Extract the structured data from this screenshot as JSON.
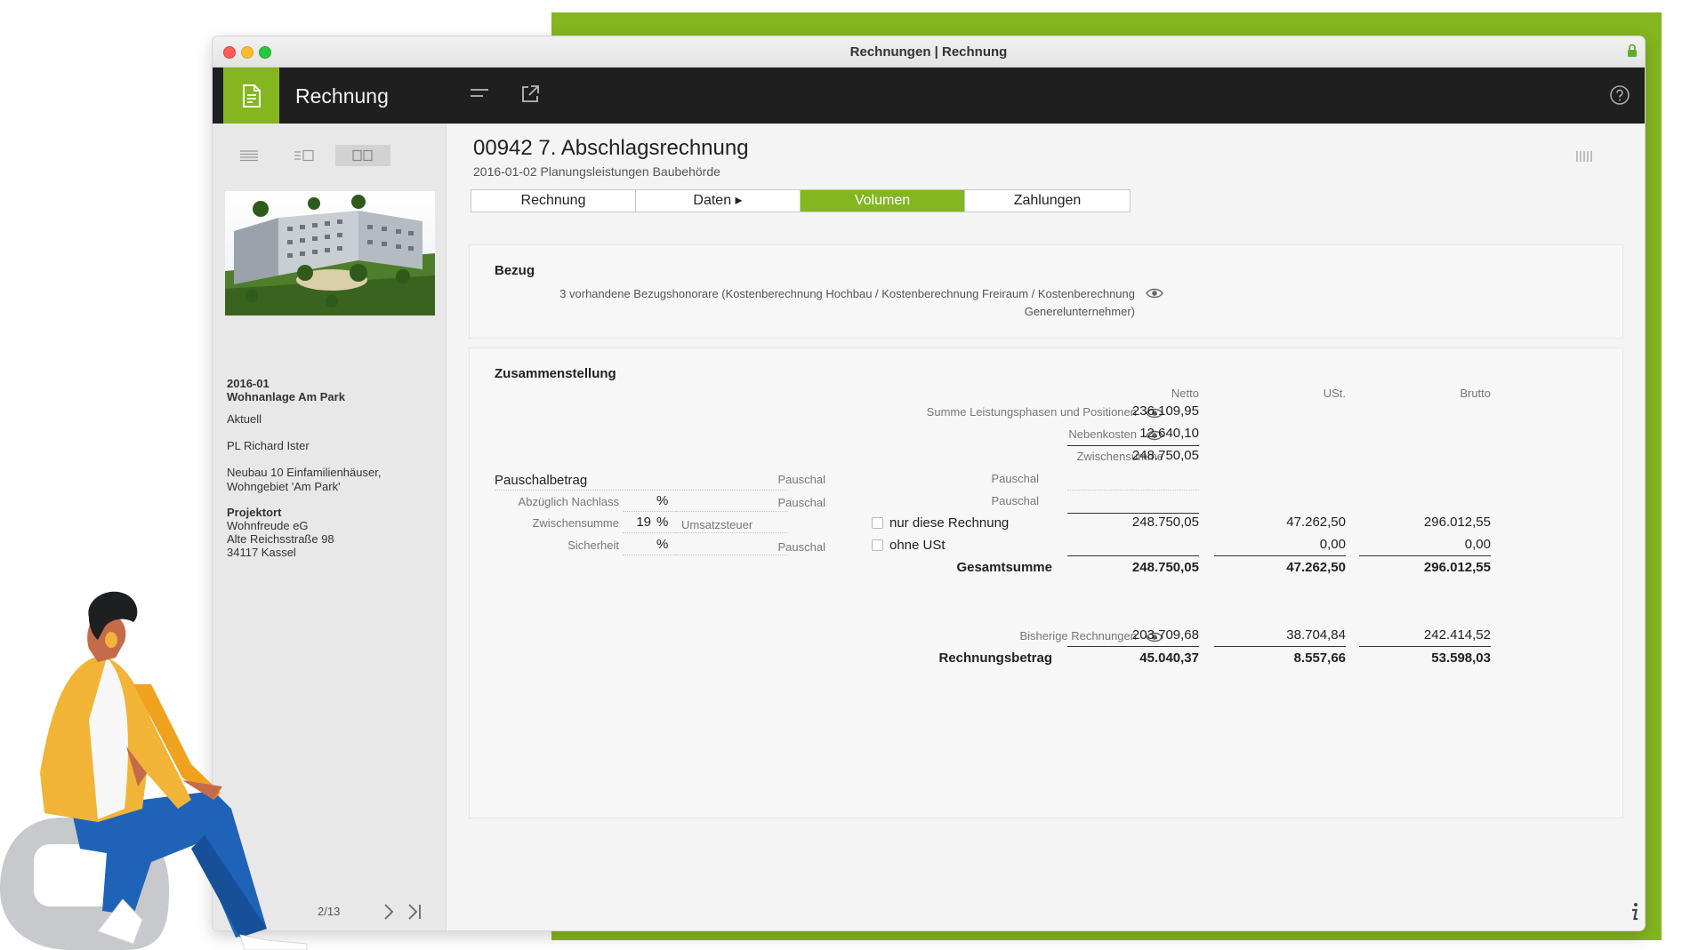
{
  "window": {
    "title": "Rechnungen | Rechnung",
    "traffic_lights": [
      "#ff5f57",
      "#febc2e",
      "#28c840"
    ]
  },
  "colors": {
    "accent": "#84b620",
    "appbar": "#1f1f1f",
    "sidebar": "#e8e8e8"
  },
  "appbar": {
    "title": "Rechnung",
    "icons": [
      "invoice-document-icon",
      "menu-lines-icon",
      "external-link-icon",
      "help-icon"
    ]
  },
  "sidebar": {
    "view_icons": [
      "list-view-icon",
      "split-view-icon",
      "grid-view-icon"
    ],
    "project_number": "2016-01",
    "project_name": "Wohnanlage Am Park",
    "status": "Aktuell",
    "manager": "PL Richard Ister",
    "description": "Neubau 10 Einfamilienhäuser, Wohngebiet 'Am Park'",
    "location_heading": "Projektort",
    "location_name": "Wohnfreude eG",
    "location_street": "Alte Reichsstraße 98",
    "location_city": "34117 Kassel",
    "pager": "2/13"
  },
  "document": {
    "title": "00942 7. Abschlagsrechnung",
    "subtitle": "2016-01-02 Planungsleistungen Baubehörde"
  },
  "tabs": [
    {
      "label": "Rechnung",
      "active": false
    },
    {
      "label": "Daten ▸",
      "active": false
    },
    {
      "label": "Volumen",
      "active": true
    },
    {
      "label": "Zahlungen",
      "active": false
    }
  ],
  "bezug": {
    "heading": "Bezug",
    "text": "3 vorhandene Bezugshonorare (Kostenberechnung Hochbau / Kostenberechnung Freiraum / Kostenberechnung Generelunternehmer)"
  },
  "zusammenstellung": {
    "heading": "Zusammenstellung",
    "columns": {
      "netto": "Netto",
      "ust": "USt.",
      "brutto": "Brutto"
    },
    "summe_label": "Summe Leistungsphasen und Positionen",
    "summe_netto": "236.109,95",
    "nebenkosten_label": "Nebenkosten",
    "nebenkosten_netto": "12.640,10",
    "zwischensumme_label": "Zwischensumme",
    "zwischensumme_netto": "248.750,05",
    "pauschalbetrag_label": "Pauschalbetrag",
    "pauschal": "Pauschal",
    "nachlass_label": "Abzüglich Nachlass",
    "percent": "%",
    "zwischensumme2_label": "Zwischensumme",
    "ust_rate": "19",
    "umsatzsteuer_label": "Umsatzsteuer",
    "sicherheit_label": "Sicherheit",
    "nur_diese_label": "nur diese Rechnung",
    "ohne_ust_label": "ohne USt",
    "row_nur_netto": "248.750,05",
    "row_nur_ust": "47.262,50",
    "row_nur_brutto": "296.012,55",
    "row_ohne_ust": "0,00",
    "row_ohne_brutto": "0,00",
    "gesamt_label": "Gesamtsumme",
    "gesamt_netto": "248.750,05",
    "gesamt_ust": "47.262,50",
    "gesamt_brutto": "296.012,55",
    "bisherige_label": "Bisherige Rechnungen",
    "bisherige_netto": "203.709,68",
    "bisherige_ust": "38.704,84",
    "bisherige_brutto": "242.414,52",
    "rechnungsbetrag_label": "Rechnungsbetrag",
    "rechnungsbetrag_netto": "45.040,37",
    "rechnungsbetrag_ust": "8.557,66",
    "rechnungsbetrag_brutto": "53.598,03"
  }
}
